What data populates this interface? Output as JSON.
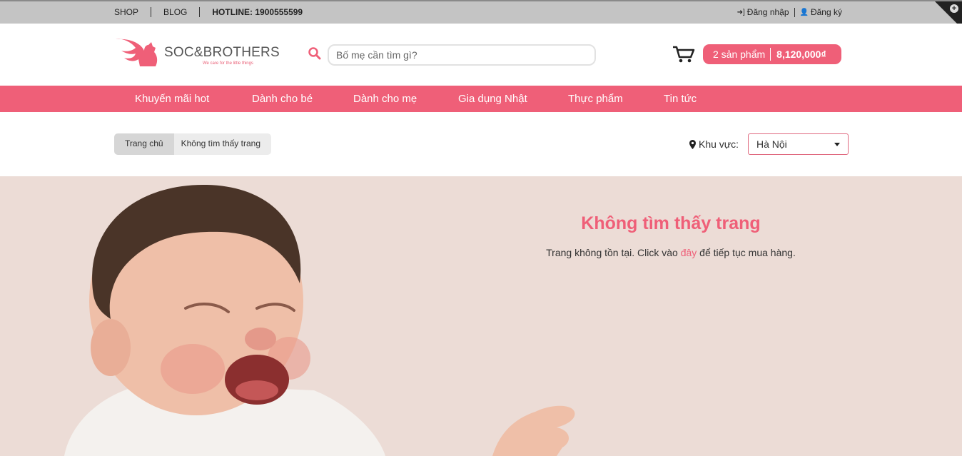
{
  "topbar": {
    "shop": "SHOP",
    "blog": "BLOG",
    "hotline": "HOTLINE: 1900555599",
    "login": "Đăng nhập",
    "register": "Đăng ký"
  },
  "header": {
    "brand": "SOC&BROTHERS",
    "tagline": "We care for the little things",
    "search_placeholder": "Bố mẹ cần tìm gì?",
    "cart_count": "2 sản phẩm",
    "cart_total": "8,120,000₫"
  },
  "nav": {
    "items": [
      "Khuyến mãi hot",
      "Dành cho bé",
      "Dành cho mẹ",
      "Gia dụng Nhật",
      "Thực phẩm",
      "Tin tức"
    ]
  },
  "breadcrumb": {
    "home": "Trang chủ",
    "current": "Không tìm thấy trang"
  },
  "region": {
    "label": "Khu vực:",
    "selected": "Hà Nội"
  },
  "error": {
    "title": "Không tìm thấy trang",
    "message_before": "Trang không tồn tại. Click vào ",
    "link": "đây",
    "message_after": " để tiếp tục mua hàng."
  },
  "colors": {
    "brand_pink": "#ef5f78",
    "topbar_gray": "#c4c4c4",
    "hero_bg": "#ecdcd6"
  },
  "icons": [
    "plus-circle-icon",
    "login-icon",
    "user-plus-icon",
    "search-icon",
    "cart-icon",
    "map-pin-icon",
    "chevron-down-icon"
  ]
}
